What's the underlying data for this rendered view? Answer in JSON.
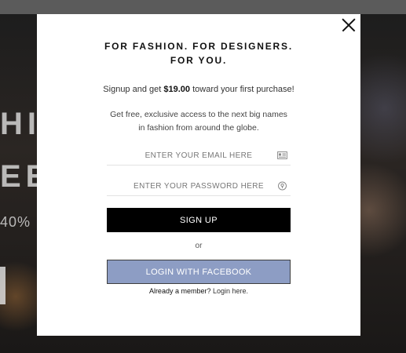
{
  "background": {
    "line1": "HI",
    "line2": "EE",
    "line3": "40%"
  },
  "modal": {
    "headline_line1": "FOR FASHION. FOR DESIGNERS.",
    "headline_line2": "FOR YOU.",
    "promo_prefix": "Signup and get ",
    "promo_amount": "$19.00",
    "promo_suffix": " toward your first purchase!",
    "description": "Get free, exclusive access to the next big names in fashion from around the globe.",
    "email_placeholder": "ENTER YOUR EMAIL HERE",
    "password_placeholder": "ENTER YOUR PASSWORD HERE",
    "signup_label": "SIGN UP",
    "or_label": "or",
    "facebook_label": "LOGIN WITH FACEBOOK",
    "member_prompt": "Already a member?",
    "login_link": "Login here."
  },
  "colors": {
    "facebook_button": "#8d9dc4",
    "signup_button": "#000000"
  },
  "icons": {
    "close": "close-icon",
    "email_field": "id-card-icon",
    "password_field": "key-icon"
  }
}
